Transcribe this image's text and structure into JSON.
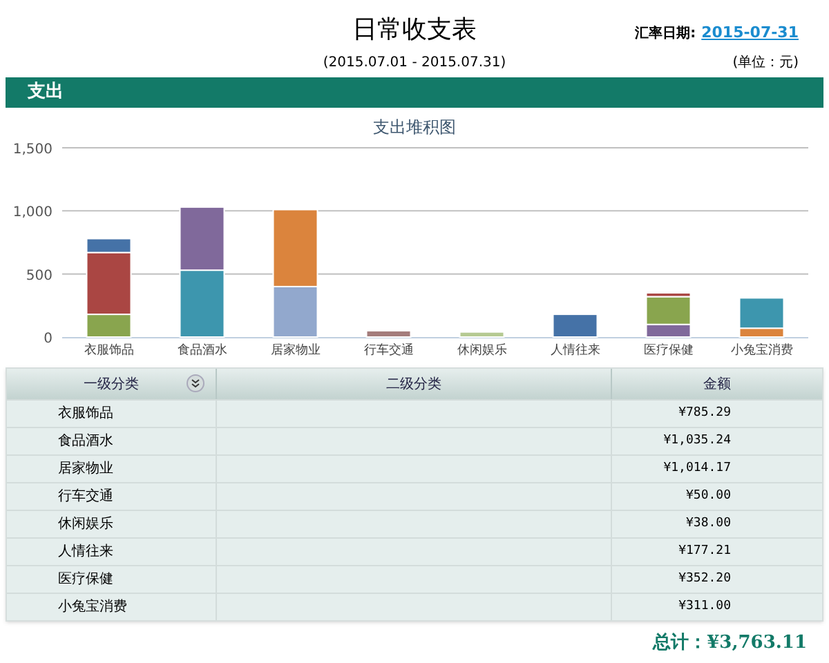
{
  "header": {
    "title": "日常收支表",
    "date_label": "汇率日期:",
    "date_link": "2015-07-31",
    "period": "(2015.07.01 - 2015.07.31)",
    "unit": "(单位：元)"
  },
  "section": {
    "title": "支出"
  },
  "chart": {
    "chart_data": {
      "type": "bar",
      "title": "支出堆积图",
      "stacked": true,
      "categories": [
        "衣服饰品",
        "食品酒水",
        "居家物业",
        "行车交通",
        "休闲娱乐",
        "人情往来",
        "医疗保健",
        "小兔宝消费"
      ],
      "ylim": [
        0,
        1500
      ],
      "yticks": [
        {
          "value": 0,
          "label": "0"
        },
        {
          "value": 500,
          "label": "500"
        },
        {
          "value": 1000,
          "label": "1,000"
        },
        {
          "value": 1500,
          "label": "1,500"
        }
      ],
      "series": [
        {
          "color": "#92a8cd",
          "values": [
            null,
            null,
            400,
            null,
            null,
            null,
            null,
            null
          ]
        },
        {
          "color": "#db843d",
          "values": [
            null,
            null,
            610,
            null,
            null,
            null,
            null,
            70
          ]
        },
        {
          "color": "#3d96ae",
          "values": [
            null,
            530,
            null,
            null,
            null,
            null,
            null,
            240
          ]
        },
        {
          "color": "#80699b",
          "values": [
            null,
            500,
            null,
            null,
            null,
            null,
            100,
            null
          ]
        },
        {
          "color": "#89a54e",
          "values": [
            180,
            null,
            null,
            null,
            null,
            null,
            220,
            null
          ]
        },
        {
          "color": "#aa4643",
          "values": [
            490,
            null,
            null,
            null,
            null,
            null,
            30,
            null
          ]
        },
        {
          "color": "#4572a7",
          "values": [
            110,
            null,
            null,
            null,
            null,
            180,
            null,
            null
          ]
        },
        {
          "color": "#a47d7c",
          "values": [
            null,
            null,
            null,
            50,
            null,
            null,
            null,
            null
          ]
        },
        {
          "color": "#b5ca92",
          "values": [
            null,
            null,
            null,
            null,
            40,
            null,
            null,
            null
          ]
        }
      ]
    }
  },
  "table": {
    "columns": [
      "一级分类",
      "二级分类",
      "金额"
    ],
    "rows": [
      {
        "category": "衣服饰品",
        "amount": "¥785.29"
      },
      {
        "category": "食品酒水",
        "amount": "¥1,035.24"
      },
      {
        "category": "居家物业",
        "amount": "¥1,014.17"
      },
      {
        "category": "行车交通",
        "amount": "¥50.00"
      },
      {
        "category": "休闲娱乐",
        "amount": "¥38.00"
      },
      {
        "category": "人情往来",
        "amount": "¥177.21"
      },
      {
        "category": "医疗保健",
        "amount": "¥352.20"
      },
      {
        "category": "小兔宝消费",
        "amount": "¥311.00"
      }
    ]
  },
  "total": "总计：¥3,763.11"
}
